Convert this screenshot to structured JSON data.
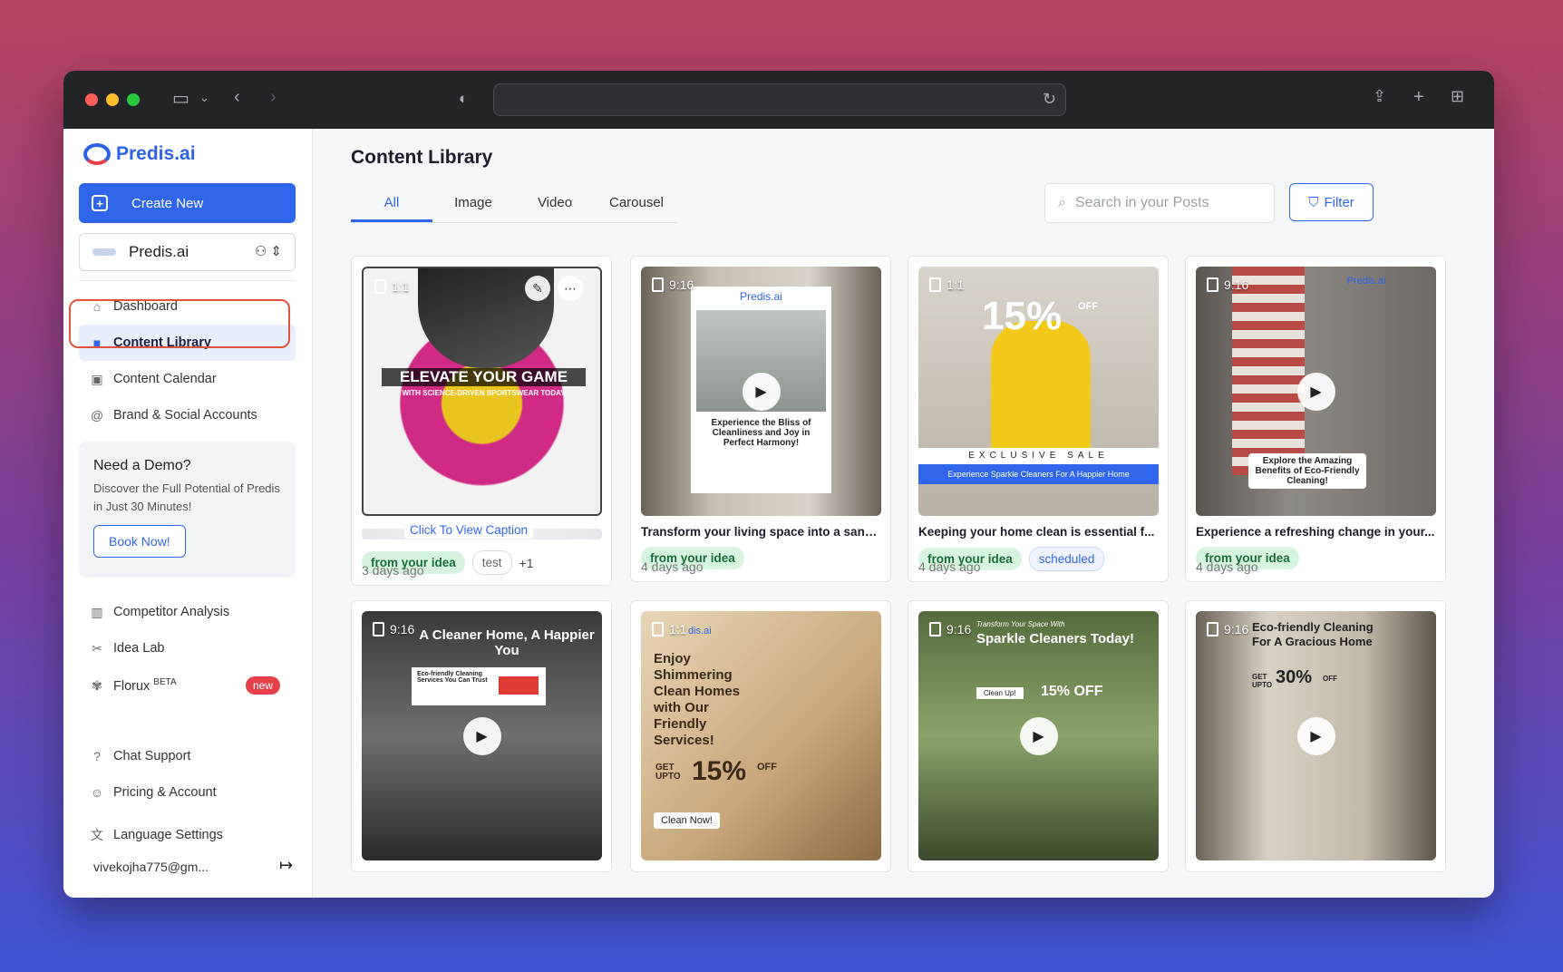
{
  "browser": {
    "url": "",
    "icons": [
      "sidebar-toggle-icon",
      "chevron-down-icon",
      "back-icon",
      "forward-icon",
      "shield-icon",
      "reload-icon",
      "share-icon",
      "new-tab-icon",
      "tab-overview-icon"
    ]
  },
  "sidebar": {
    "brand": "Predis.ai",
    "create_label": "Create New",
    "workspace": "Predis.ai",
    "nav": [
      {
        "label": "Dashboard",
        "icon": "home-icon"
      },
      {
        "label": "Content Library",
        "icon": "library-icon",
        "active": true
      },
      {
        "label": "Content Calendar",
        "icon": "calendar-icon"
      },
      {
        "label": "Brand & Social Accounts",
        "icon": "at-icon"
      }
    ],
    "demo": {
      "title": "Need a Demo?",
      "text": "Discover the Full Potential of Predis in Just 30 Minutes!",
      "button": "Book Now!"
    },
    "nav2": [
      {
        "label": "Competitor Analysis",
        "icon": "chart-icon"
      },
      {
        "label": "Idea Lab",
        "icon": "idea-icon"
      },
      {
        "label": "Florux",
        "icon": "florux-icon",
        "beta": "BETA",
        "badge": "new"
      }
    ],
    "nav3": [
      {
        "label": "Chat Support",
        "icon": "help-icon"
      },
      {
        "label": "Pricing & Account",
        "icon": "user-icon"
      },
      {
        "label": "Language Settings",
        "icon": "translate-icon"
      }
    ],
    "account": "vivekojha775@gm..."
  },
  "main": {
    "title": "Content Library",
    "tabs": [
      "All",
      "Image",
      "Video",
      "Carousel"
    ],
    "active_tab": "All",
    "search_placeholder": "Search in your Posts",
    "filter_label": "Filter",
    "view_caption": "Click To View Caption",
    "posts": [
      {
        "ratio": "1:1",
        "caption": "",
        "tags": [
          "from your idea",
          "test"
        ],
        "more": "+1",
        "date": "3 days ago",
        "overlay": "ELEVATE YOUR GAME",
        "overlay_sub": "WITH SCIENCE-DRIVEN SPORTSWEAR TODAY"
      },
      {
        "ratio": "9:16",
        "caption": "Transform your living space into a sanc...",
        "tags": [
          "from your idea"
        ],
        "date": "4 days ago",
        "overlay": "Experience the Bliss of Cleanliness and Joy in Perfect Harmony!",
        "brand": "Predis.ai"
      },
      {
        "ratio": "1:1",
        "caption": "Keeping your home clean is essential f...",
        "tags": [
          "from your idea",
          "scheduled"
        ],
        "date": "4 days ago",
        "overlay": "15%",
        "overlay_off": "OFF",
        "sale": "EXCLUSIVE SALE",
        "banner": "Experience Sparkle Cleaners For A Happier Home"
      },
      {
        "ratio": "9:16",
        "caption": "Experience a refreshing change in your...",
        "tags": [
          "from your idea"
        ],
        "date": "4 days ago",
        "overlay": "Explore the Amazing Benefits of Eco-Friendly Cleaning!",
        "brand": "Predis.ai"
      },
      {
        "ratio": "9:16",
        "overlay": "A Cleaner Home, A Happier You",
        "overlay_sub": "Eco-friendly Cleaning Services You Can Trust"
      },
      {
        "ratio": "1:1",
        "overlay": "Enjoy Shimmering Clean Homes with Our Friendly Services!",
        "discount": "15%",
        "get": "GET UPTO",
        "off": "OFF",
        "cta": "Clean Now!",
        "brand": "dis.ai"
      },
      {
        "ratio": "9:16",
        "overlay": "Sparkle Cleaners Today!",
        "overlay_sub": "Transform Your Space With",
        "discount": "15% OFF",
        "cta": "Clean Up!"
      },
      {
        "ratio": "9:16",
        "overlay": "Eco-friendly Cleaning For A Gracious Home",
        "discount": "30%",
        "get": "GET UPTO",
        "off": "OFF"
      }
    ]
  },
  "colors": {
    "accent": "#2f66ec",
    "highlight": "#e2553a",
    "tag_green": "#d6f4df",
    "badge_new": "#e8404a"
  }
}
